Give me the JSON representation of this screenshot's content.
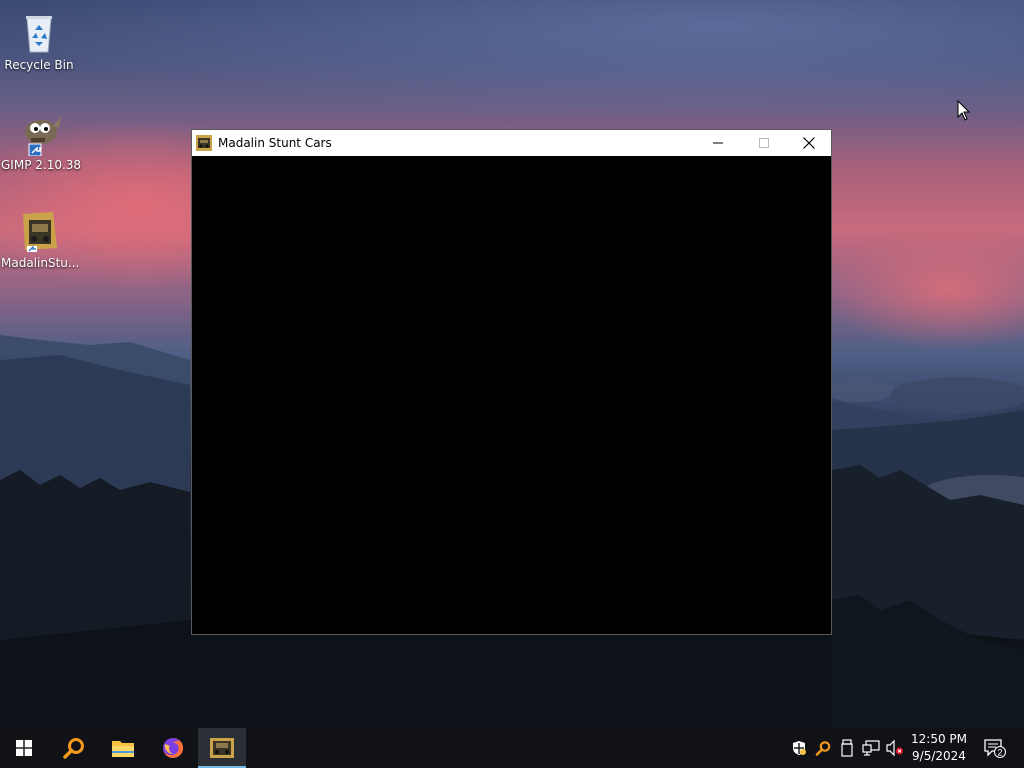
{
  "desktop": {
    "icons": [
      {
        "label": "Recycle Bin",
        "icon": "recycle-bin-icon"
      },
      {
        "label": "GIMP 2.10.38",
        "icon": "gimp-icon"
      },
      {
        "label": "MadalinStu...",
        "icon": "game-shortcut-icon"
      }
    ]
  },
  "window": {
    "title": "Madalin Stunt Cars",
    "icon": "car-game-icon",
    "buttons": {
      "minimize": "minimize-icon",
      "maximize": "maximize-icon",
      "close": "close-icon"
    }
  },
  "taskbar": {
    "start": "windows-logo-icon",
    "search": "search-icon",
    "apps": [
      {
        "name": "file-explorer-icon"
      },
      {
        "name": "firefox-icon"
      },
      {
        "name": "car-game-icon",
        "active": true
      }
    ],
    "tray": {
      "icons": [
        "security-shield-icon",
        "search-tray-icon",
        "usb-device-icon",
        "network-icon",
        "volume-muted-icon"
      ],
      "time": "12:50 PM",
      "date": "9/5/2024",
      "notifications_count": "2"
    }
  },
  "colors": {
    "taskbar_bg": "#101216",
    "active_indicator": "#76b9ed",
    "window_bg": "#000000",
    "titlebar_bg": "#ffffff"
  }
}
